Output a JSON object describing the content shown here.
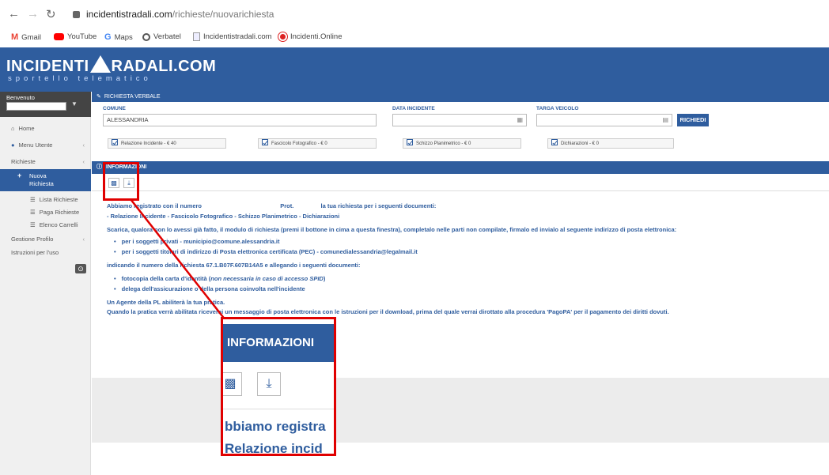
{
  "browser": {
    "url_domain": "incidentistradali.com",
    "url_path": "/richieste/nuovarichiesta"
  },
  "bookmarks": [
    {
      "label": "Gmail",
      "icon": "gmail-icon",
      "color": "#ea4335"
    },
    {
      "label": "YouTube",
      "icon": "youtube-icon",
      "color": "#ff0000"
    },
    {
      "label": "Maps",
      "icon": "maps-icon",
      "color": "#4285f4"
    },
    {
      "label": "Verbatel",
      "icon": "verbatel-icon",
      "color": "#555555"
    },
    {
      "label": "Incidentistradali.com",
      "icon": "doc-icon",
      "color": "#888888"
    },
    {
      "label": "Incidenti.Online",
      "icon": "incidenti-icon",
      "color": "#d22"
    }
  ],
  "site": {
    "logo_left": "INCIDENTI",
    "logo_right": "RADALI.COM",
    "subtitle": "sportello telematico"
  },
  "sidebar": {
    "welcome": "Benvenuto",
    "items": [
      {
        "label": "Home",
        "icon": "home-icon"
      },
      {
        "label": "Menu Utente",
        "icon": "user-icon"
      },
      {
        "label": "Richieste"
      },
      {
        "label": "Nuova"
      },
      {
        "label": "Richiesta"
      },
      {
        "label": "Lista Richieste",
        "icon": "list-icon"
      },
      {
        "label": "Paga Richieste",
        "icon": "list-icon"
      },
      {
        "label": "Elenco Carrelli",
        "icon": "list-icon"
      },
      {
        "label": "Gestione Profilo"
      },
      {
        "label": "Istruzioni per l'uso"
      }
    ]
  },
  "form": {
    "panel_title": "RICHIESTA VERBALE",
    "comune_label": "COMUNE",
    "comune_value": "ALESSANDRIA",
    "data_label": "DATA INCIDENTE",
    "targa_label": "TARGA VEICOLO",
    "submit_label": "RICHIEDI"
  },
  "documents": [
    {
      "label": "Relazione Incidente - € 40"
    },
    {
      "label": "Fascicolo Fotografico - € 0"
    },
    {
      "label": "Schizzo Planimetrico - € 0"
    },
    {
      "label": "Dichiarazioni - € 0"
    }
  ],
  "info": {
    "title": "INFORMAZIONI",
    "line1_a": "Abbiamo registrato con il numero",
    "line1_b": "Prot.",
    "line1_c": "la tua richiesta per i seguenti documenti:",
    "line2": "- Relazione Incidente - Fascicolo Fotografico - Schizzo Planimetrico - Dichiarazioni",
    "line3": "Scarica, qualora non lo avessi già fatto, il modulo di richiesta (premi il bottone in cima a questa finestra), completalo nelle parti non compilate, firmalo ed invialo al seguente indirizzo di posta elettronica:",
    "bullet1": "per i soggetti privati - municipio@comune.alessandria.it",
    "bullet2": "per i soggetti titolari di indirizzo di Posta elettronica certificata (PEC) - comunedialessandria@legalmail.it",
    "line4": "indicando il numero della richiesta 67.1.B07F.607B14A5 e allegando i seguenti documenti:",
    "bullet3_a": "fotocopia della carta d'identità (",
    "bullet3_b": "non necessaria in caso di accesso SPID",
    "bullet3_c": ")",
    "bullet4": "delega dell'assicurazione o della persona coinvolta nell'incidente",
    "line5": "Un Agente della PL abiliterà la tua pratica.",
    "line6": "Quando la pratica verrà abilitata riceverai un messaggio di posta elettronica con le istruzioni per il download, prima del quale verrai dirottato alla procedura 'PagoPA' per il pagamento dei diritti dovuti."
  },
  "zoom": {
    "title": "INFORMAZIONI",
    "text1": "bbiamo registra",
    "text2": "Relazione incid"
  },
  "colors": {
    "primary": "#2f5d9e",
    "callout": "#e00000"
  }
}
